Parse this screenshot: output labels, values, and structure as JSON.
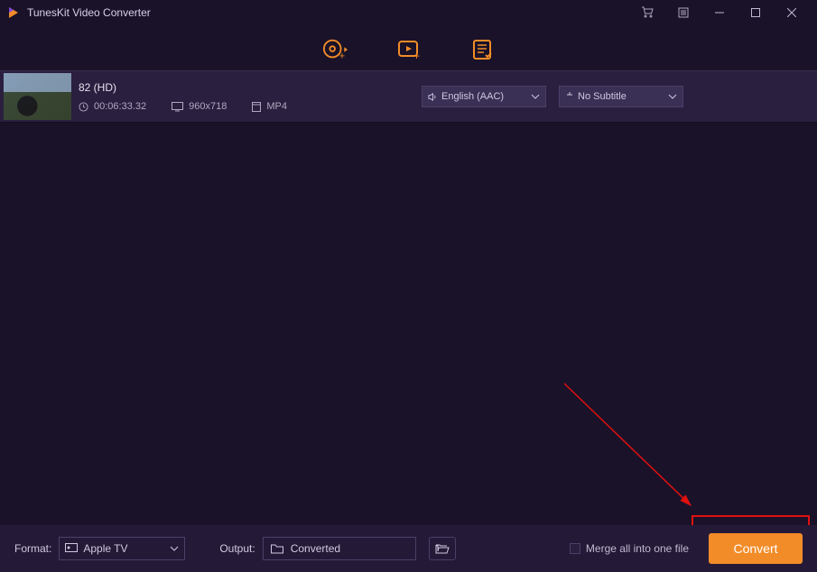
{
  "title": "TunesKit Video Converter",
  "toolbar": {
    "disc_label": "Add Disc",
    "video_label": "Add Video",
    "list_label": "Converted"
  },
  "file": {
    "name": "82 (HD)",
    "duration": "00:06:33.32",
    "resolution": "960x718",
    "container": "MP4",
    "audio_track": "English (AAC)",
    "subtitle": "No Subtitle"
  },
  "bottom": {
    "format_label": "Format:",
    "format_value": "Apple TV",
    "output_label": "Output:",
    "output_value": "Converted",
    "merge_label": "Merge all into one file",
    "convert_label": "Convert"
  },
  "colors": {
    "accent": "#f28c28",
    "annotate": "#e01010"
  }
}
